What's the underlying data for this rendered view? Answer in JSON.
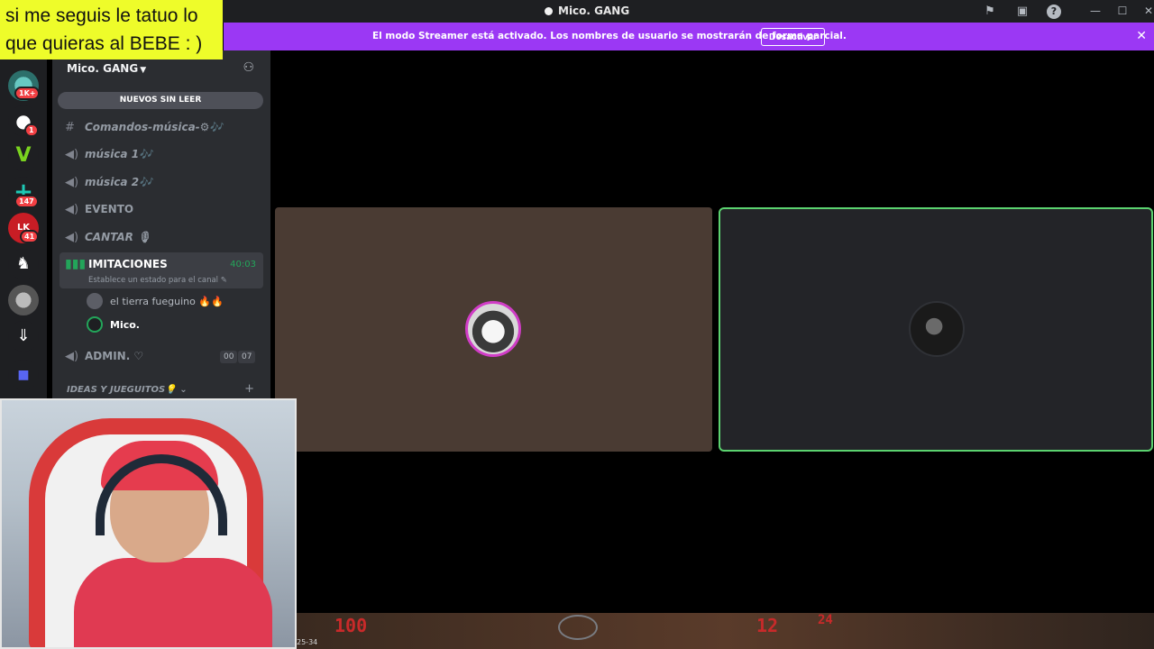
{
  "titlebar": {
    "title": "Mico. GANG",
    "icons": [
      "flag-icon",
      "inbox-icon",
      "help-icon"
    ],
    "window_controls": [
      "minimize",
      "maximize",
      "close"
    ]
  },
  "banner": {
    "message": "El modo Streamer está activado. Los nombres de usuario se mostrarán de forma parcial.",
    "button_label": "Desactivar",
    "close_glyph": "✕",
    "color": "#9b38f4"
  },
  "overlay": {
    "text_line1": "si me seguis le tatuo lo",
    "text_line2": "que quieras al BEBE : )"
  },
  "guilds": {
    "badges": [
      "1K+",
      "1",
      "147",
      "41"
    ]
  },
  "channels": {
    "server_name": "Mico. GANG",
    "new_unread": "NUEVOS SIN LEER",
    "list": [
      {
        "icon": "#",
        "label": "Comandos-música-⚙🎶"
      },
      {
        "icon": "🔊",
        "label": "música 1🎶"
      },
      {
        "icon": "🔊",
        "label": "música 2🎶"
      },
      {
        "icon": "🔊",
        "label": "EVENTO"
      },
      {
        "icon": "🔊",
        "label": "CANTAR 🎙"
      }
    ],
    "active": {
      "name": "IMITACIONES",
      "time": "40:03",
      "status": "Establece un estado para el canal ✎",
      "users": [
        {
          "name": "el tierra fueguino 🔥🔥"
        },
        {
          "name": "Mico."
        }
      ]
    },
    "admin": {
      "label": "ADMIN. ♡",
      "count_a": "00",
      "count_b": "07"
    },
    "category": "IDEAS Y JUEGUITOS💡",
    "category_chevron": "⌄"
  },
  "hud": {
    "health": "100",
    "ammo": "12",
    "reserve": "24",
    "score": "25-34"
  },
  "colors": {
    "accent_green": "#23a55a",
    "speaking_border": "#5bd26f"
  }
}
